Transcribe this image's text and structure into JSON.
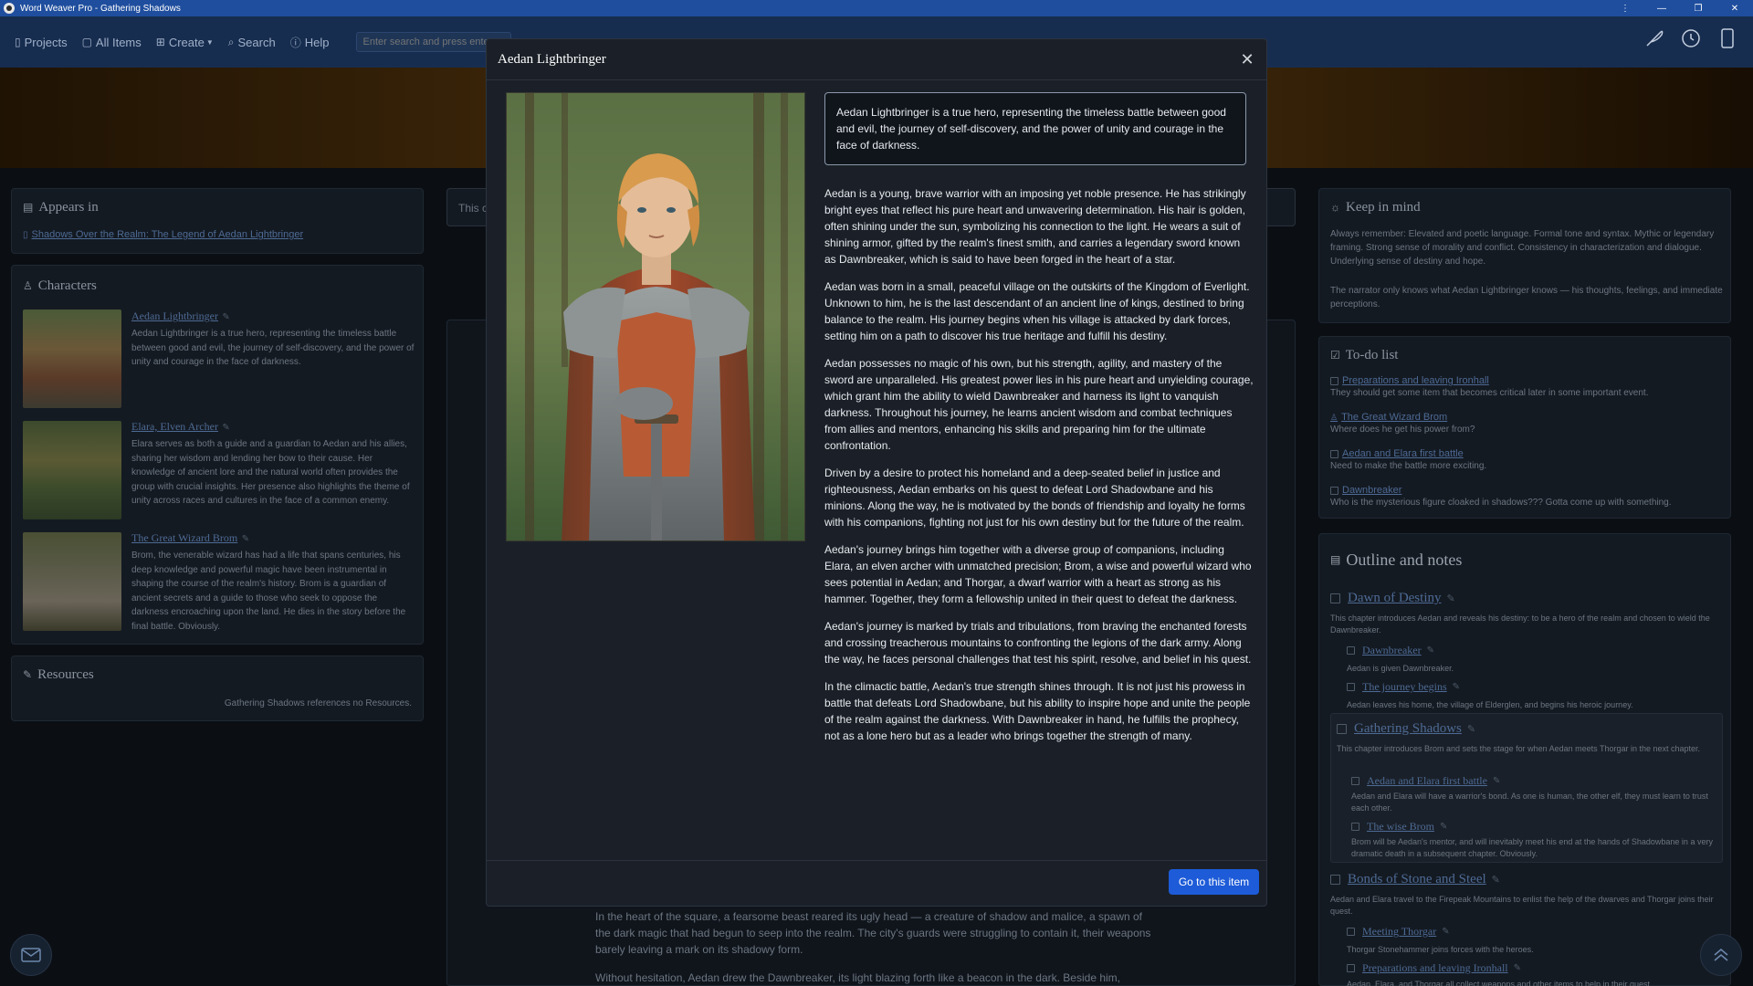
{
  "window": {
    "title": "Word Weaver Pro - Gathering Shadows"
  },
  "nav": {
    "items": [
      {
        "label": "Projects",
        "icon": "book-icon"
      },
      {
        "label": "All Items",
        "icon": "file-icon"
      },
      {
        "label": "Create",
        "icon": "plus-square-icon"
      },
      {
        "label": "Search",
        "icon": "search-icon"
      },
      {
        "label": "Help",
        "icon": "help-icon"
      }
    ],
    "search_placeholder": "Enter search and press enter"
  },
  "appears_in": {
    "title": "Appears in",
    "link": "Shadows Over the Realm: The Legend of Aedan Lightbringer"
  },
  "characters": {
    "title": "Characters",
    "items": [
      {
        "name": "Aedan Lightbringer",
        "desc": "Aedan Lightbringer is a true hero, representing the timeless battle between good and evil, the journey of self-discovery, and the power of unity and courage in the face of darkness."
      },
      {
        "name": "Elara, Elven Archer",
        "desc": "Elara serves as both a guide and a guardian to Aedan and his allies, sharing her wisdom and lending her bow to their cause. Her knowledge of ancient lore and the natural world often provides the group with crucial insights. Her presence also highlights the theme of unity across races and cultures in the face of a common enemy."
      },
      {
        "name": "The Great Wizard Brom",
        "desc": "Brom, the venerable wizard has had a life that spans centuries, his deep knowledge and powerful magic have been instrumental in shaping the course of the realm's history. Brom is a guardian of ancient secrets and a guide to those who seek to oppose the darkness encroaching upon the land. He dies in the story before the final battle. Obviously."
      }
    ]
  },
  "resources": {
    "title": "Resources",
    "note": "Gathering Shadows references no Resources."
  },
  "center_behind": {
    "prefix": "This c",
    "para1": "In the heart of the square, a fearsome beast reared its ugly head — a creature of shadow and malice, a spawn of the dark magic that had begun to seep into the realm. The city's guards were struggling to contain it, their weapons barely leaving a mark on its shadowy form.",
    "para2": "Without hesitation, Aedan drew the Dawnbreaker, its light blazing forth like a beacon in the dark. Beside him,"
  },
  "keep_in_mind": {
    "title": "Keep in mind",
    "p1": "Always remember: Elevated and poetic language. Formal tone and syntax. Mythic or legendary framing. Strong sense of morality and conflict. Consistency in characterization and dialogue. Underlying sense of destiny and hope.",
    "p2": "The narrator only knows what Aedan Lightbringer knows — his thoughts, feelings, and immediate perceptions."
  },
  "todo": {
    "title": "To-do list",
    "items": [
      {
        "title": "Preparations and leaving Ironhall",
        "note": "They should get some item that becomes critical later in some important event."
      },
      {
        "title": "The Great Wizard Brom",
        "note": "Where does he get his power from?"
      },
      {
        "title": "Aedan and Elara first battle",
        "note": "Need to make the battle more exciting."
      },
      {
        "title": "Dawnbreaker",
        "note": "Who is the mysterious figure cloaked in shadows??? Gotta come up with something."
      }
    ]
  },
  "outline": {
    "title": "Outline and notes",
    "ch1": {
      "title": "Dawn of Destiny",
      "note": "This chapter introduces Aedan and reveals his destiny: to be a hero of the realm and chosen to wield the Dawnbreaker."
    },
    "ch1_s1": {
      "title": "Dawnbreaker",
      "note": "Aedan is given Dawnbreaker."
    },
    "ch1_s2": {
      "title": "The journey begins",
      "note": "Aedan leaves his home, the village of Elderglen, and begins his heroic journey."
    },
    "ch2": {
      "title": "Gathering Shadows",
      "note": "This chapter introduces Brom and sets the stage for when Aedan meets Thorgar in the next chapter."
    },
    "ch2_s1": {
      "title": "Aedan and Elara first battle",
      "note": "Aedan and Elara will have a warrior's bond. As one is human, the other elf, they must learn to trust each other."
    },
    "ch2_s2": {
      "title": "The wise Brom",
      "note": "Brom will be Aedan's mentor, and will inevitably meet his end at the hands of Shadowbane in a very dramatic death in a subsequent chapter. Obviously."
    },
    "ch3": {
      "title": "Bonds of Stone and Steel",
      "note": "Aedan and Elara travel to the Firepeak Mountains to enlist the help of the dwarves and Thorgar joins their quest."
    },
    "ch3_s1": {
      "title": "Meeting Thorgar",
      "note": "Thorgar Stonehammer joins forces with the heroes."
    },
    "ch3_s2": {
      "title": "Preparations and leaving Ironhall",
      "note": "Aedan, Elara, and Thorgar all collect weapons and other items to help in their quest."
    }
  },
  "modal": {
    "title": "Aedan Lightbringer",
    "summary": "Aedan Lightbringer is a true hero, representing the timeless battle between good and evil, the journey of self-discovery, and the power of unity and courage in the face of darkness.",
    "paragraphs": [
      "Aedan is a young, brave warrior with an imposing yet noble presence. He has strikingly bright eyes that reflect his pure heart and unwavering determination. His hair is golden, often shining under the sun, symbolizing his connection to the light. He wears a suit of shining armor, gifted by the realm's finest smith, and carries a legendary sword known as Dawnbreaker, which is said to have been forged in the heart of a star.",
      "Aedan was born in a small, peaceful village on the outskirts of the Kingdom of Everlight. Unknown to him, he is the last descendant of an ancient line of kings, destined to bring balance to the realm. His journey begins when his village is attacked by dark forces, setting him on a path to discover his true heritage and fulfill his destiny.",
      "Aedan possesses no magic of his own, but his strength, agility, and mastery of the sword are unparalleled. His greatest power lies in his pure heart and unyielding courage, which grant him the ability to wield Dawnbreaker and harness its light to vanquish darkness. Throughout his journey, he learns ancient wisdom and combat techniques from allies and mentors, enhancing his skills and preparing him for the ultimate confrontation.",
      "Driven by a desire to protect his homeland and a deep-seated belief in justice and righteousness, Aedan embarks on his quest to defeat Lord Shadowbane and his minions. Along the way, he is motivated by the bonds of friendship and loyalty he forms with his companions, fighting not just for his own destiny but for the future of the realm.",
      "Aedan's journey brings him together with a diverse group of companions, including Elara, an elven archer with unmatched precision; Brom, a wise and powerful wizard who sees potential in Aedan; and Thorgar, a dwarf warrior with a heart as strong as his hammer. Together, they form a fellowship united in their quest to defeat the darkness.",
      "Aedan's journey is marked by trials and tribulations, from braving the enchanted forests and crossing treacherous mountains to confronting the legions of the dark army. Along the way, he faces personal challenges that test his spirit, resolve, and belief in his quest.",
      "In the climactic battle, Aedan's true strength shines through. It is not just his prowess in battle that defeats Lord Shadowbane, but his ability to inspire hope and unite the people of the realm against the darkness. With Dawnbreaker in hand, he fulfills the prophecy, not as a lone hero but as a leader who brings together the strength of many."
    ],
    "button": "Go to this item"
  },
  "colors": {
    "accent": "#1d5bd8",
    "titlebar": "#1f4e9e",
    "navbar": "#172d4f",
    "modal_bg": "#1b2028"
  }
}
